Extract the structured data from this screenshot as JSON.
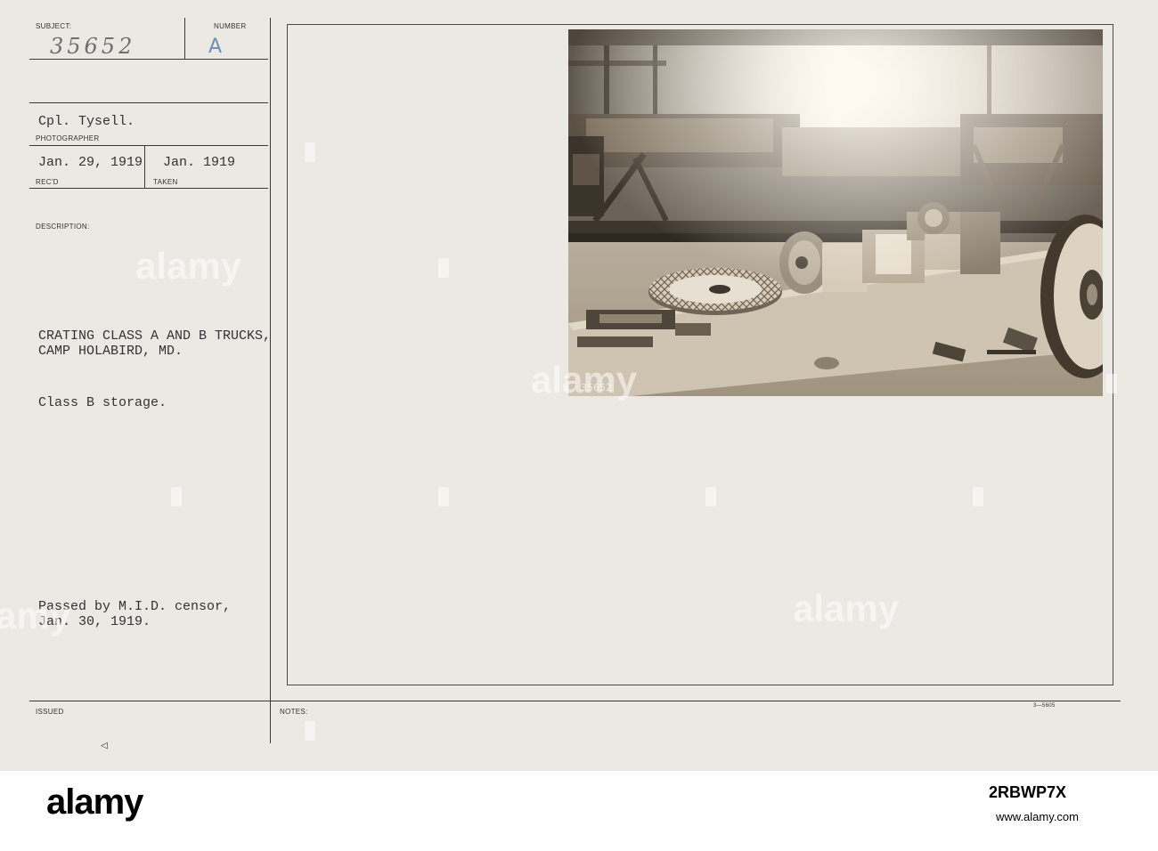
{
  "card": {
    "subject_label": "SUBJECT:",
    "number_label": "NUMBER",
    "subject_number": "35652",
    "number_letter": "A",
    "photographer": "Cpl. Tysell.",
    "photographer_label": "PHOTOGRAPHER",
    "recd_date": "Jan. 29, 1919",
    "taken_date": "Jan.  1919",
    "recd_label": "REC'D",
    "taken_label": "TAKEN",
    "description_label": "DESCRIPTION:",
    "description_line1": "CRATING CLASS A AND B TRUCKS,",
    "description_line2": "CAMP HOLABIRD, MD.",
    "description_line3": "Class B storage.",
    "censor_line1": "Passed by M.I.D. censor,",
    "censor_line2": "Jan. 30, 1919.",
    "issued_label": "ISSUED",
    "notes_label": "NOTES:",
    "form_number": "3—5605",
    "arrow_mark": "◁",
    "photo_number": "35652"
  },
  "footer": {
    "logo": "alamy",
    "image_id": "2RBWP7X",
    "url": "www.alamy.com"
  },
  "watermark": {
    "text": "alamy"
  }
}
